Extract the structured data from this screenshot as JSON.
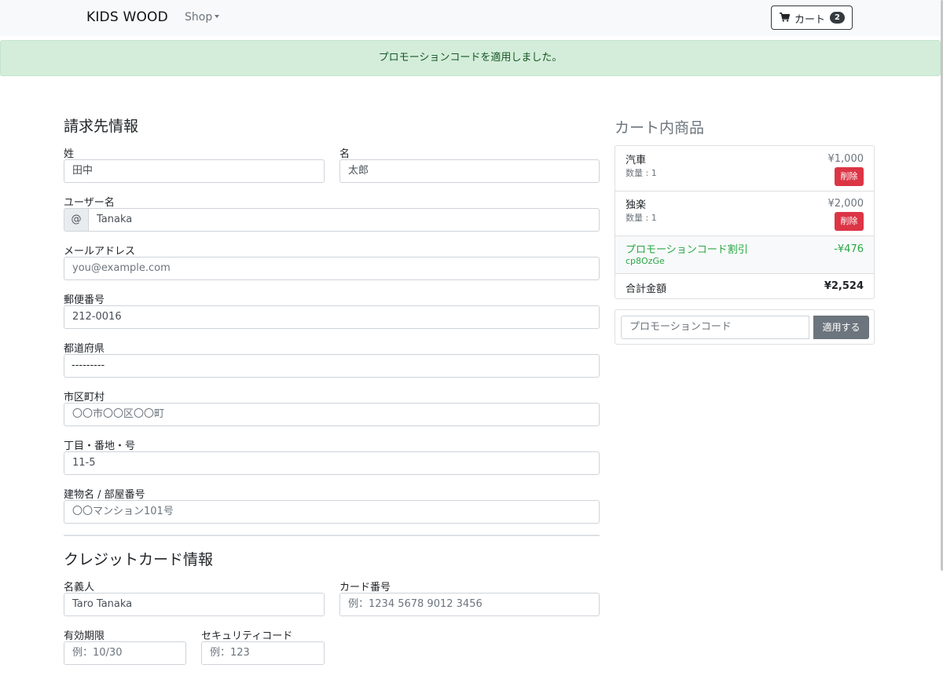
{
  "nav": {
    "brand": "KIDS WOOD",
    "shop_label": "Shop",
    "cart_label": "カート",
    "cart_count": "2"
  },
  "alert": {
    "message": "プロモーションコードを適用しました。"
  },
  "billing": {
    "title": "請求先情報",
    "last_name": {
      "label": "姓",
      "value": "田中"
    },
    "first_name": {
      "label": "名",
      "value": "太郎"
    },
    "username": {
      "label": "ユーザー名",
      "addon": "@",
      "value": "Tanaka"
    },
    "email": {
      "label": "メールアドレス",
      "placeholder": "you@example.com"
    },
    "postal": {
      "label": "郵便番号",
      "value": "212-0016"
    },
    "prefecture": {
      "label": "都道府県",
      "value": "---------"
    },
    "city": {
      "label": "市区町村",
      "placeholder": "〇〇市〇〇区〇〇町"
    },
    "address": {
      "label": "丁目・番地・号",
      "value": "11-5"
    },
    "building": {
      "label": "建物名 / 部屋番号",
      "placeholder": "〇〇マンション101号"
    }
  },
  "card": {
    "title": "クレジットカード情報",
    "holder": {
      "label": "名義人",
      "value": "Taro Tanaka"
    },
    "number": {
      "label": "カード番号",
      "placeholder": "例：1234 5678 9012 3456"
    },
    "expiry": {
      "label": "有効期限",
      "placeholder": "例：10/30"
    },
    "cvc": {
      "label": "セキュリティコード",
      "placeholder": "例：123"
    }
  },
  "cart": {
    "title": "カート内商品",
    "items": [
      {
        "name": "汽車",
        "qty": "数量 : 1",
        "price": "¥1,000",
        "delete_label": "削除"
      },
      {
        "name": "独楽",
        "qty": "数量 : 1",
        "price": "¥2,000",
        "delete_label": "削除"
      }
    ],
    "promo": {
      "name": "プロモーションコード割引",
      "code": "cp8OzGe",
      "amount": "-¥476"
    },
    "total": {
      "label": "合計金額",
      "value": "¥2,524"
    },
    "promo_input": {
      "placeholder": "プロモーションコード",
      "button_label": "適用する"
    }
  },
  "colors": {
    "alert_bg": "#d4edda",
    "alert_text": "#155724",
    "danger": "#dc3545",
    "success": "#28a745",
    "secondary": "#6c757d"
  },
  "icons": {
    "cart": "cart-icon",
    "shop_dropdown": "caret-down-icon"
  }
}
